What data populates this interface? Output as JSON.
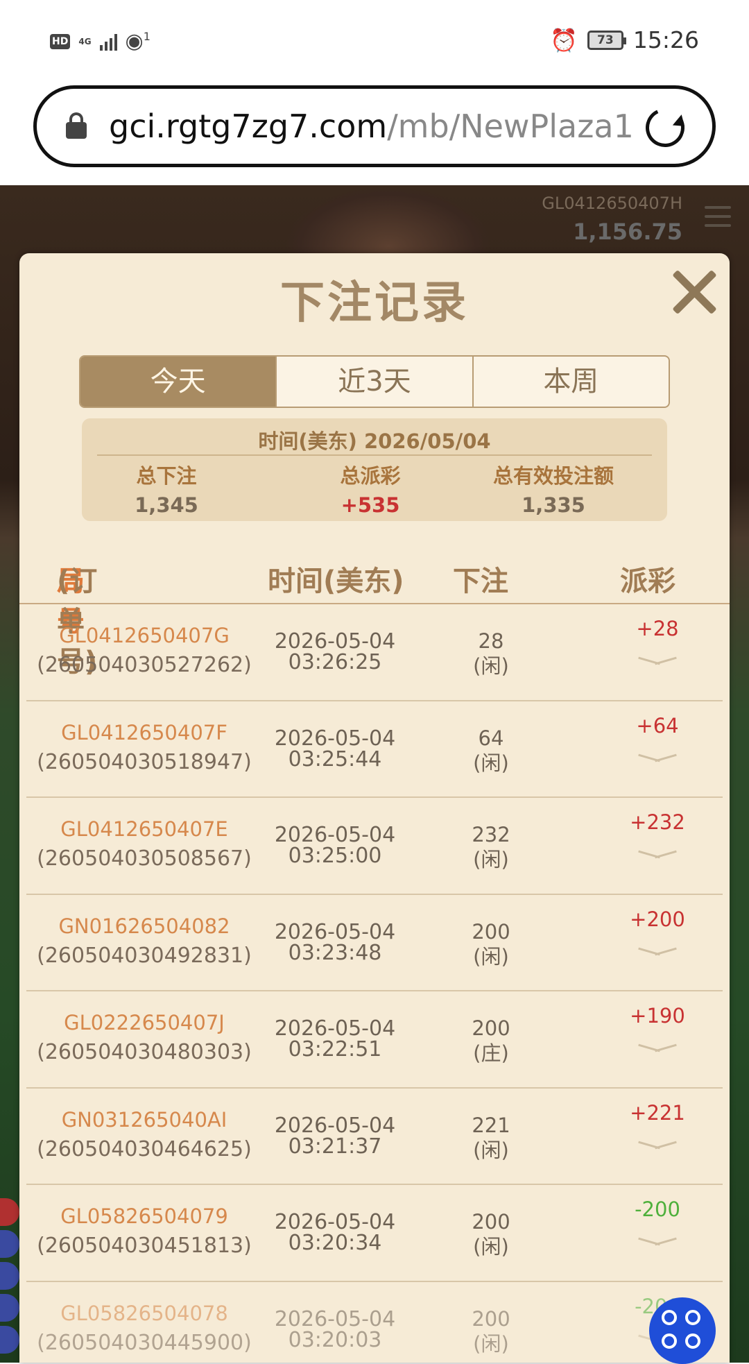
{
  "status_bar": {
    "hd": "HD",
    "network": "4G",
    "hotspot_count": "1",
    "battery": "73",
    "time": "15:26"
  },
  "browser": {
    "url_host": "gci.rgtg7zg7.com",
    "url_path": "/mb/NewPlaza1"
  },
  "game": {
    "account_id": "GL0412650407H",
    "balance": "1,156.75"
  },
  "modal": {
    "title": "下注记录",
    "tabs": [
      {
        "label": "今天",
        "active": true
      },
      {
        "label": "近3天",
        "active": false
      },
      {
        "label": "本周",
        "active": false
      }
    ],
    "summary": {
      "date_line": "时间(美东) 2026/05/04",
      "total_bet_label": "总下注",
      "total_bet": "1,345",
      "total_payout_label": "总派彩",
      "total_payout": "+535",
      "total_valid_label": "总有效投注额",
      "total_valid": "1,335"
    },
    "columns": {
      "round_main": "局号",
      "round_sub": "(订单号)",
      "time": "时间(美东)",
      "bet": "下注",
      "payout": "派彩"
    },
    "rows": [
      {
        "round": "GL0412650407G",
        "order": "(260504030527262)",
        "date": "2026-05-04",
        "time": "03:26:25",
        "bet": "28",
        "side": "(闲)",
        "payout": "+28",
        "payout_sign": "pos"
      },
      {
        "round": "GL0412650407F",
        "order": "(260504030518947)",
        "date": "2026-05-04",
        "time": "03:25:44",
        "bet": "64",
        "side": "(闲)",
        "payout": "+64",
        "payout_sign": "pos"
      },
      {
        "round": "GL0412650407E",
        "order": "(260504030508567)",
        "date": "2026-05-04",
        "time": "03:25:00",
        "bet": "232",
        "side": "(闲)",
        "payout": "+232",
        "payout_sign": "pos"
      },
      {
        "round": "GN01626504082",
        "order": "(260504030492831)",
        "date": "2026-05-04",
        "time": "03:23:48",
        "bet": "200",
        "side": "(闲)",
        "payout": "+200",
        "payout_sign": "pos"
      },
      {
        "round": "GL0222650407J",
        "order": "(260504030480303)",
        "date": "2026-05-04",
        "time": "03:22:51",
        "bet": "200",
        "side": "(庄)",
        "payout": "+190",
        "payout_sign": "pos"
      },
      {
        "round": "GN031265040AI",
        "order": "(260504030464625)",
        "date": "2026-05-04",
        "time": "03:21:37",
        "bet": "221",
        "side": "(闲)",
        "payout": "+221",
        "payout_sign": "pos"
      },
      {
        "round": "GL05826504079",
        "order": "(260504030451813)",
        "date": "2026-05-04",
        "time": "03:20:34",
        "bet": "200",
        "side": "(闲)",
        "payout": "-200",
        "payout_sign": "neg"
      },
      {
        "round": "GL05826504078",
        "order": "(260504030445900)",
        "date": "2026-05-04",
        "time": "03:20:03",
        "bet": "200",
        "side": "(闲)",
        "payout": "-200",
        "payout_sign": "neg"
      }
    ]
  },
  "colors": {
    "modal_bg": "#f6ebd6",
    "accent_gold": "#a88b62",
    "positive": "#c83232",
    "negative": "#4fb03c",
    "round_id": "#d6884c"
  },
  "fab": {
    "icon": "four-circles-icon"
  }
}
